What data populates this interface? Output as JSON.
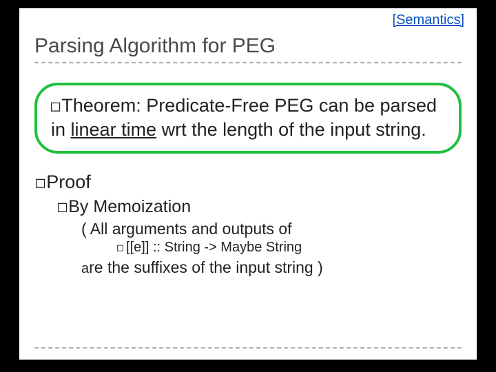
{
  "tag": "[Semantics]",
  "title": "Parsing Algorithm for PEG",
  "theorem": {
    "label": "Theorem:",
    "body": " Predicate-Free PEG can be parsed in ",
    "emph": "linear time",
    "rest": " wrt the length of the input string."
  },
  "proof": {
    "label": "Proof",
    "by": "By Memoization",
    "line1": "( All arguments and outputs of",
    "code": "[[e]] :: String -> Maybe String",
    "line2a": "a",
    "line2b": "re the suffixes of the input string )"
  }
}
